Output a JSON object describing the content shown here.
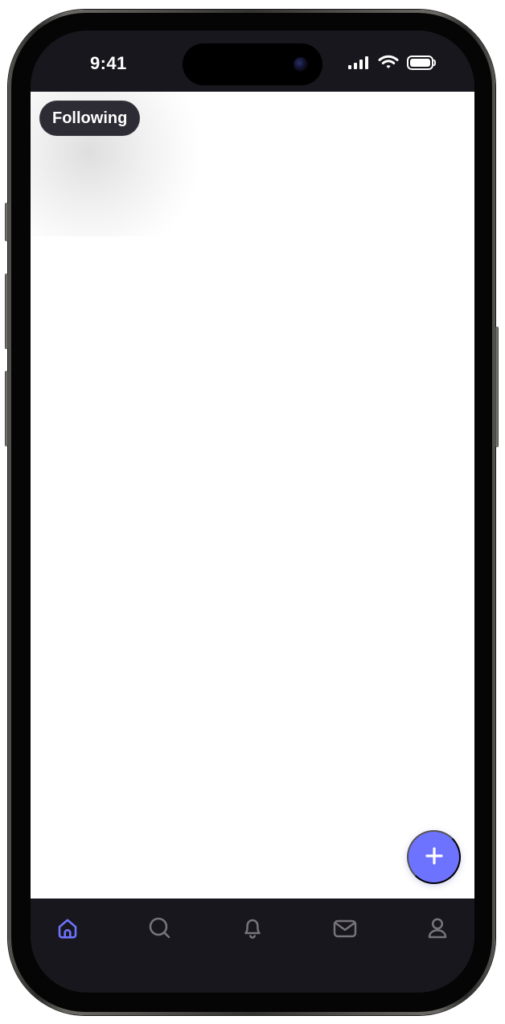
{
  "status_bar": {
    "time": "9:41"
  },
  "feed": {
    "filter_label": "Following"
  },
  "fab": {
    "icon": "plus-icon"
  },
  "bottom_nav": {
    "items": [
      {
        "icon": "home-icon",
        "active": true
      },
      {
        "icon": "search-icon",
        "active": false
      },
      {
        "icon": "bell-icon",
        "active": false
      },
      {
        "icon": "mail-icon",
        "active": false
      },
      {
        "icon": "profile-icon",
        "active": false
      }
    ]
  },
  "colors": {
    "accent": "#6E73FF",
    "dark_chrome": "#17171D",
    "pill_background": "#2D2C34",
    "inactive_icon": "#77737A",
    "content_background": "#FFFFFF"
  }
}
